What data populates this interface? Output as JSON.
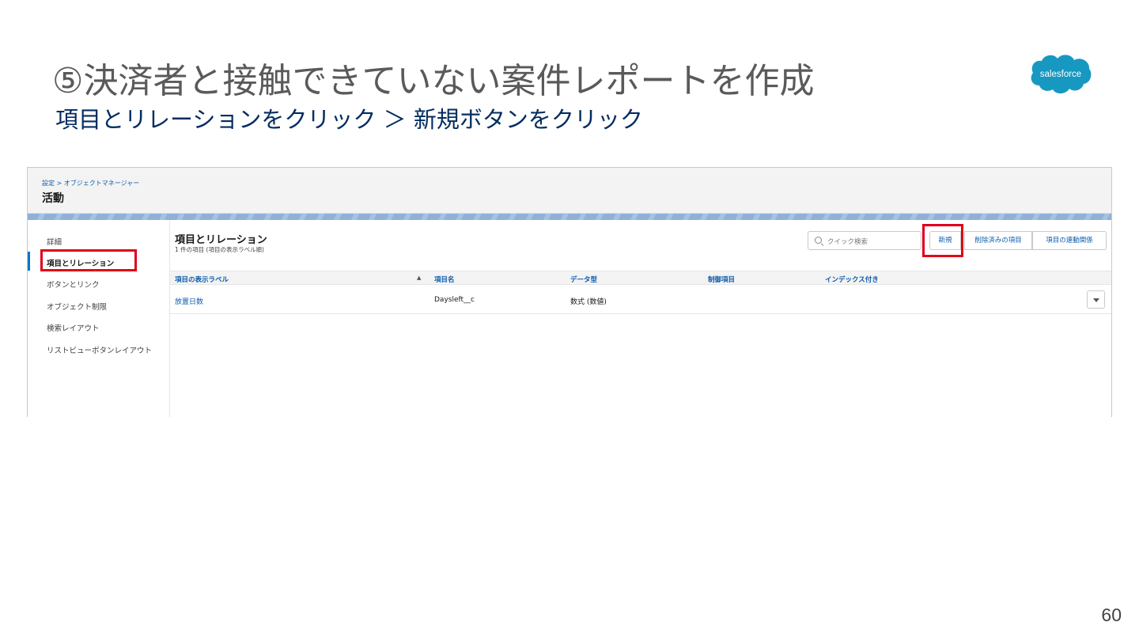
{
  "slide": {
    "title": "⑤決済者と接触できていない案件レポートを作成",
    "subtitle": "項目とリレーションをクリック ＞ 新規ボタンをクリック",
    "logo_text": "salesforce",
    "page_number": "60"
  },
  "header": {
    "breadcrumb": "設定 > オブジェクトマネージャー",
    "object_title": "活動"
  },
  "sidebar": {
    "items": [
      {
        "label": "詳細"
      },
      {
        "label": "項目とリレーション"
      },
      {
        "label": "ボタンとリンク"
      },
      {
        "label": "オブジェクト制限"
      },
      {
        "label": "検索レイアウト"
      },
      {
        "label": "リストビューボタンレイアウト"
      }
    ],
    "active_index": 1
  },
  "main": {
    "title": "項目とリレーション",
    "subtitle": "1 件の項目 (項目の表示ラベル順)",
    "search_placeholder": "クイック検索",
    "buttons": {
      "new": "新規",
      "deleted_fields": "削除済みの項目",
      "field_dependencies": "項目の連動関係"
    },
    "table": {
      "columns": [
        "項目の表示ラベル",
        "項目名",
        "データ型",
        "制御項目",
        "インデックス付き"
      ],
      "rows": [
        [
          "放置日数",
          "Daysleft__c",
          "数式 (数値)",
          "",
          ""
        ]
      ]
    }
  },
  "colors": {
    "highlight": "#e0001a",
    "link": "#0b5cab",
    "subtitle": "#032d60",
    "logo": "#1798c1"
  }
}
